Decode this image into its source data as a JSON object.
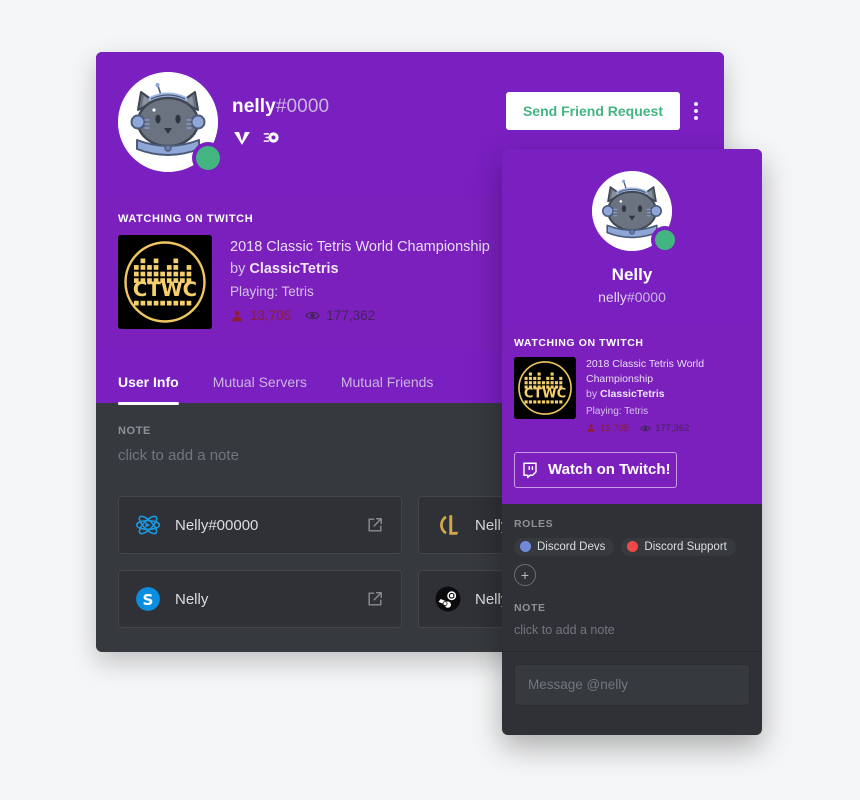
{
  "profile_card": {
    "username": "nelly",
    "discriminator": "#0000",
    "badges": [
      {
        "name": "hypesquad-badge",
        "title": "HypeSquad"
      },
      {
        "name": "partner-badge",
        "title": "Discord Partner"
      }
    ],
    "status": "online",
    "actions": {
      "friend_request_label": "Send Friend Request",
      "more_label": "More"
    },
    "activity": {
      "section_label": "Watching on Twitch",
      "title": "2018 Classic Tetris World Championship",
      "by_prefix": "by",
      "streamer": "ClassicTetris",
      "playing": "Playing: Tetris",
      "viewers": "13,705",
      "views": "177,362",
      "logo_text": "CTWC"
    },
    "tabs": [
      {
        "label": "User Info",
        "active": true
      },
      {
        "label": "Mutual Servers",
        "active": false
      },
      {
        "label": "Mutual Friends",
        "active": false
      }
    ],
    "note": {
      "label": "Note",
      "placeholder": "click to add a note"
    },
    "connections": [
      {
        "service": "battlenet",
        "name": "Nelly#00000"
      },
      {
        "service": "leagueoflegends",
        "name": "Nelly"
      },
      {
        "service": "skype",
        "name": "Nelly"
      },
      {
        "service": "steam",
        "name": "Nelly"
      }
    ]
  },
  "popout_card": {
    "display_name": "Nelly",
    "username": "nelly",
    "discriminator": "#0000",
    "status": "online",
    "activity": {
      "section_label": "Watching on Twitch",
      "title": "2018 Classic Tetris World Championship",
      "by_prefix": "by",
      "streamer": "ClassicTetris",
      "playing": "Playing: Tetris",
      "viewers": "13,705",
      "views": "177,362",
      "logo_text": "CTWC"
    },
    "watch_button_label": "Watch on Twitch!",
    "roles": {
      "label": "Roles",
      "items": [
        {
          "label": "Discord Devs",
          "color": "#7289da"
        },
        {
          "label": "Discord Support",
          "color": "#f04747"
        }
      ],
      "add_label": "+"
    },
    "note": {
      "label": "Note",
      "placeholder": "click to add a note"
    },
    "message_placeholder": "Message @nelly"
  },
  "colors": {
    "accent_purple": "#7a1fc0",
    "activity_purple": "#7b20bd",
    "dark_body": "#36393e",
    "popout_body": "#2f3136",
    "online_green": "#43b581",
    "friend_button_text": "#43b581",
    "role_devs": "#7289da",
    "role_support": "#f04747"
  }
}
